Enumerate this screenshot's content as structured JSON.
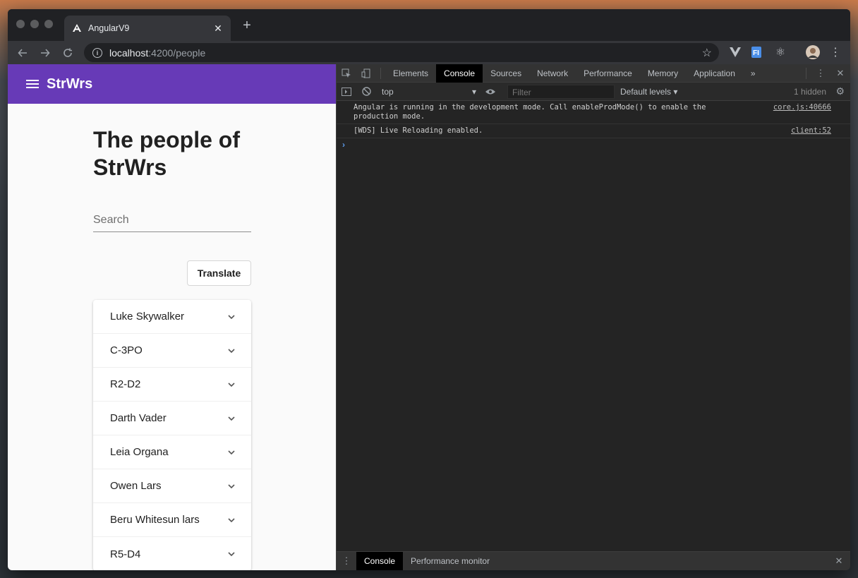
{
  "browser": {
    "tab_title": "AngularV9",
    "tab_close": "✕",
    "new_tab": "+",
    "url_host": "localhost",
    "url_rest": ":4200/people",
    "info_glyph": "i",
    "extension_react": "⚛"
  },
  "app": {
    "title": "StrWrs",
    "heading": "The people of StrWrs",
    "search_placeholder": "Search",
    "translate_label": "Translate",
    "people": [
      "Luke Skywalker",
      "C-3PO",
      "R2-D2",
      "Darth Vader",
      "Leia Organa",
      "Owen Lars",
      "Beru Whitesun lars",
      "R5-D4"
    ],
    "brand_color": "#673ab7"
  },
  "devtools": {
    "tabs": [
      "Elements",
      "Console",
      "Sources",
      "Network",
      "Performance",
      "Memory",
      "Application"
    ],
    "active_tab": "Console",
    "more_tabs": "»",
    "context": "top",
    "filter_placeholder": "Filter",
    "levels": "Default levels ▾",
    "hidden_count": "1 hidden",
    "messages": [
      {
        "text": "Angular is running in the development mode. Call enableProdMode() to enable the production mode.",
        "source": "core.js:40666"
      },
      {
        "text": "[WDS] Live Reloading enabled.",
        "source": "client:52"
      }
    ],
    "prompt": "›",
    "drawer_tabs": [
      "Console",
      "Performance monitor"
    ]
  }
}
